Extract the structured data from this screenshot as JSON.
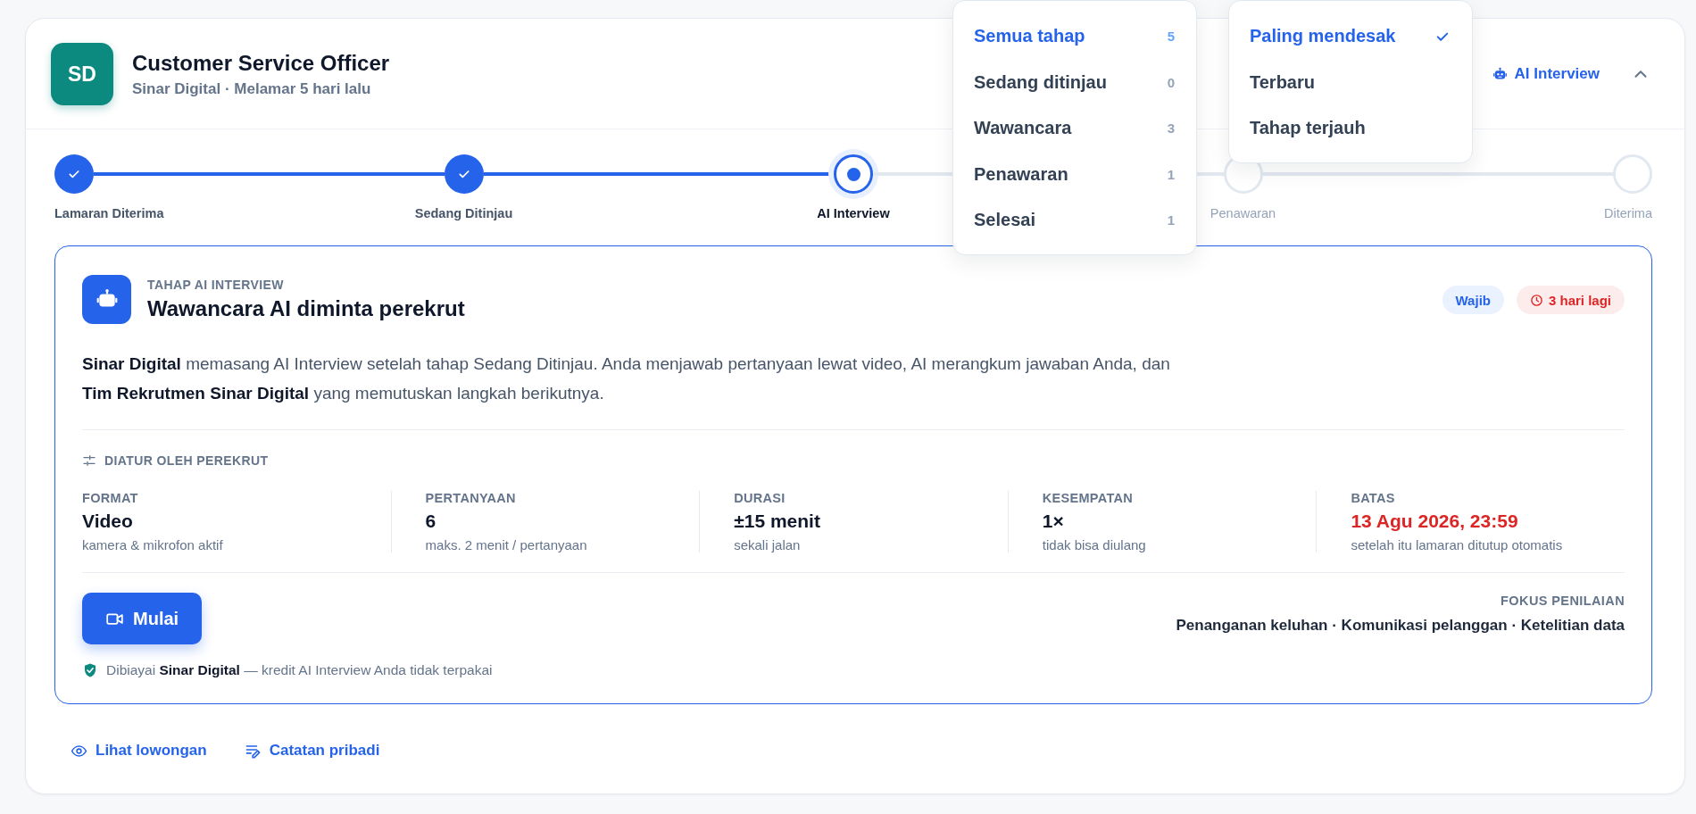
{
  "job": {
    "initials": "SD",
    "title": "Customer Service Officer",
    "subtitle": "Sinar Digital · Melamar 5 hari lalu"
  },
  "header_actions": {
    "ai_link": "AI Interview",
    "expanded": true
  },
  "steps": [
    {
      "label": "Lamaran Diterima",
      "done": true,
      "current": false
    },
    {
      "label": "Sedang Ditinjau",
      "done": true,
      "current": false
    },
    {
      "label": "AI Interview",
      "done": false,
      "current": true
    },
    {
      "label": "Penawaran",
      "done": false,
      "current": false
    },
    {
      "label": "Diterima",
      "done": false,
      "current": false
    }
  ],
  "stage_menu": [
    {
      "label": "Semua tahap",
      "count": "5",
      "selected": true
    },
    {
      "label": "Sedang ditinjau",
      "count": "0",
      "selected": false
    },
    {
      "label": "Wawancara",
      "count": "3",
      "selected": false
    },
    {
      "label": "Penawaran",
      "count": "1",
      "selected": false
    },
    {
      "label": "Selesai",
      "count": "1",
      "selected": false
    }
  ],
  "sort_menu": [
    {
      "label": "Paling mendesak",
      "selected": true
    },
    {
      "label": "Terbaru",
      "selected": false
    },
    {
      "label": "Tahap terjauh",
      "selected": false
    }
  ],
  "stage_card": {
    "eyebrow": "TAHAP AI INTERVIEW",
    "title": "Wawancara AI diminta perekrut",
    "badges": [
      {
        "kind": "info",
        "text": "Wajib"
      },
      {
        "kind": "deadline",
        "text": "3 hari lagi"
      }
    ],
    "description": "**Sinar Digital** memasang AI Interview setelah tahap Sedang Ditinjau. Anda menjawab pertanyaan lewat video, AI merangkum jawaban Anda, dan **Tim Rekrutmen Sinar Digital** yang memutuskan langkah berikutnya.",
    "settings_heading": "DIATUR OLEH PEREKRUT",
    "settings": [
      {
        "label": "FORMAT",
        "value": "Video",
        "note": "kamera & mikrofon aktif",
        "urgent": false
      },
      {
        "label": "PERTANYAAN",
        "value": "6",
        "note": "maks. 2 menit / pertanyaan",
        "urgent": false
      },
      {
        "label": "DURASI",
        "value": "±15 menit",
        "note": "sekali jalan",
        "urgent": false
      },
      {
        "label": "KESEMPATAN",
        "value": "1×",
        "note": "tidak bisa diulang",
        "urgent": false
      },
      {
        "label": "BATAS",
        "value": "13 Agu 2026, 23:59",
        "note": "setelah itu lamaran ditutup otomatis",
        "urgent": true
      }
    ],
    "start_button": "Mulai",
    "funding_note": "Dibiayai **Sinar Digital** — kredit AI Interview Anda tidak terpakai",
    "focus_label": "FOKUS PENILAIAN",
    "focus": "Penanganan keluhan · Komunikasi pelanggan · Ketelitian data"
  },
  "footer_links": [
    {
      "kind": "view",
      "label": "Lihat lowongan"
    },
    {
      "kind": "notes",
      "label": "Catatan pribadi"
    }
  ]
}
